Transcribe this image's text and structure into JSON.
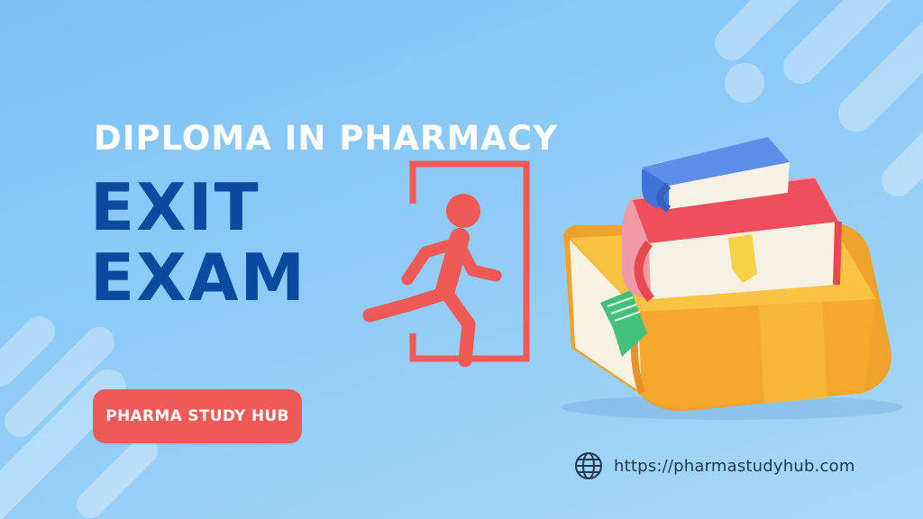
{
  "banner": {
    "subtitle": "DIPLOMA IN PHARMACY",
    "headline_line1": "EXIT",
    "headline_line2": "EXAM",
    "brand_label": "PHARMA STUDY HUB",
    "website_url": "https://pharmastudyhub.com"
  },
  "icons": {
    "exit": "running-person-exit-icon",
    "books": "stacked-books-illustration",
    "globe": "globe-icon"
  },
  "colors": {
    "background": "#8fcbf7",
    "subtitle_text": "#ffffff",
    "headline_text": "#0b4a9e",
    "accent_red": "#ef5a57",
    "url_text": "#24364c",
    "book_blue": "#3f73d6",
    "book_red": "#ee4f5c",
    "book_yellow": "#f6b534"
  }
}
